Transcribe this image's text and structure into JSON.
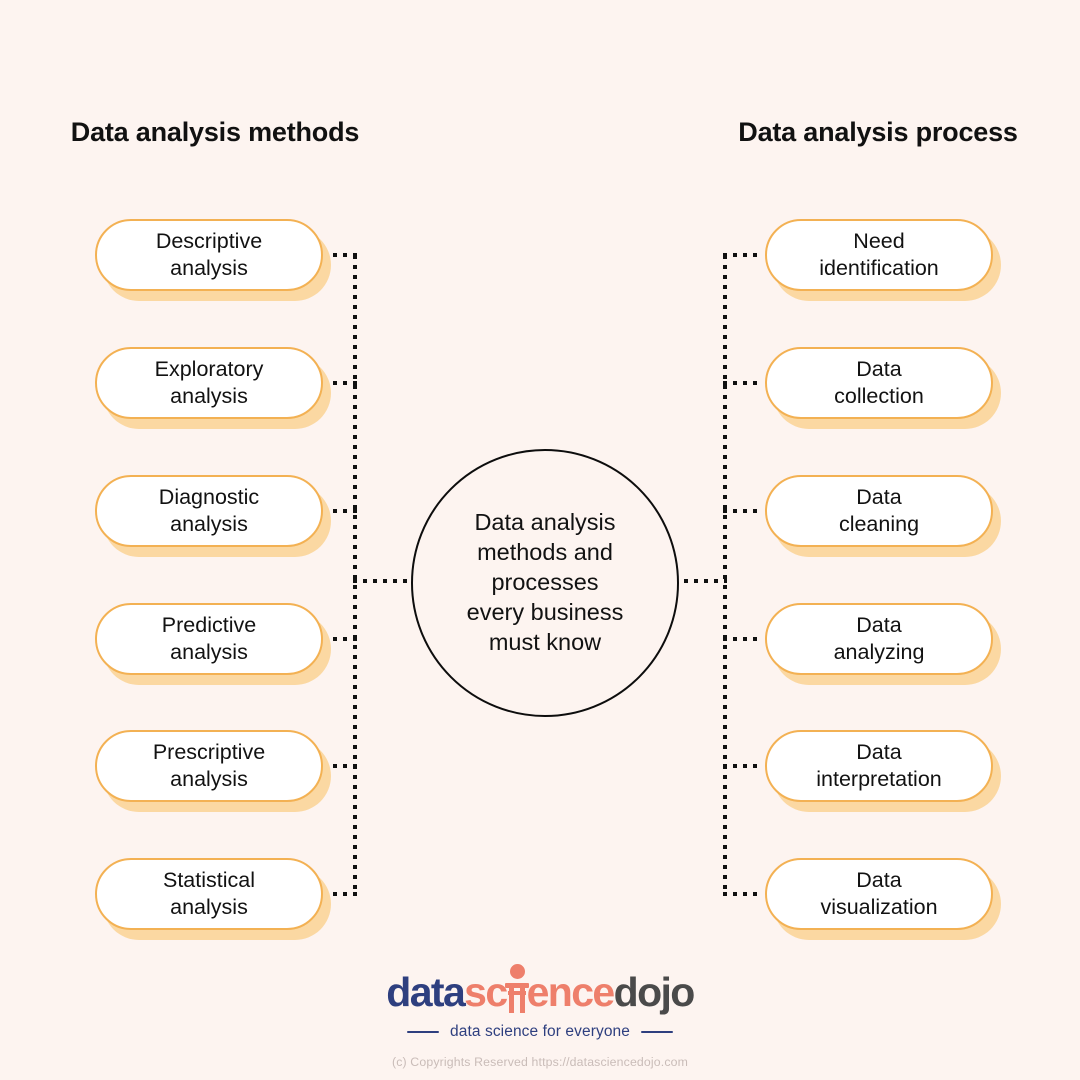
{
  "background_color": "#fdf4f0",
  "accent_color": "#f3b153",
  "shadow_color": "#fbd8a2",
  "center": {
    "text": "Data analysis\nmethods and\nprocesses\nevery business\nmust know"
  },
  "left_column": {
    "heading": "Data analysis\nmethods",
    "items": [
      {
        "label": "Descriptive\nanalysis"
      },
      {
        "label": "Exploratory\nanalysis"
      },
      {
        "label": "Diagnostic\nanalysis"
      },
      {
        "label": "Predictive\nanalysis"
      },
      {
        "label": "Prescriptive\nanalysis"
      },
      {
        "label": "Statistical\nanalysis"
      }
    ]
  },
  "right_column": {
    "heading": "Data analysis\nprocess",
    "items": [
      {
        "label": "Need\nidentification"
      },
      {
        "label": "Data\ncollection"
      },
      {
        "label": "Data\ncleaning"
      },
      {
        "label": "Data\nanalyzing"
      },
      {
        "label": "Data\ninterpretation"
      },
      {
        "label": "Data\nvisualization"
      }
    ]
  },
  "footer": {
    "logo": {
      "part1": "data",
      "part2": "sc",
      "part3": "ence",
      "part4": "dojo",
      "part1_color": "#2e3f7f",
      "part2_color": "#ee7f6b",
      "part4_color": "#4a4a4a"
    },
    "tagline": "data science for everyone",
    "copyright": "(c) Copyrights Reserved  https://datasciencedojo.com"
  }
}
